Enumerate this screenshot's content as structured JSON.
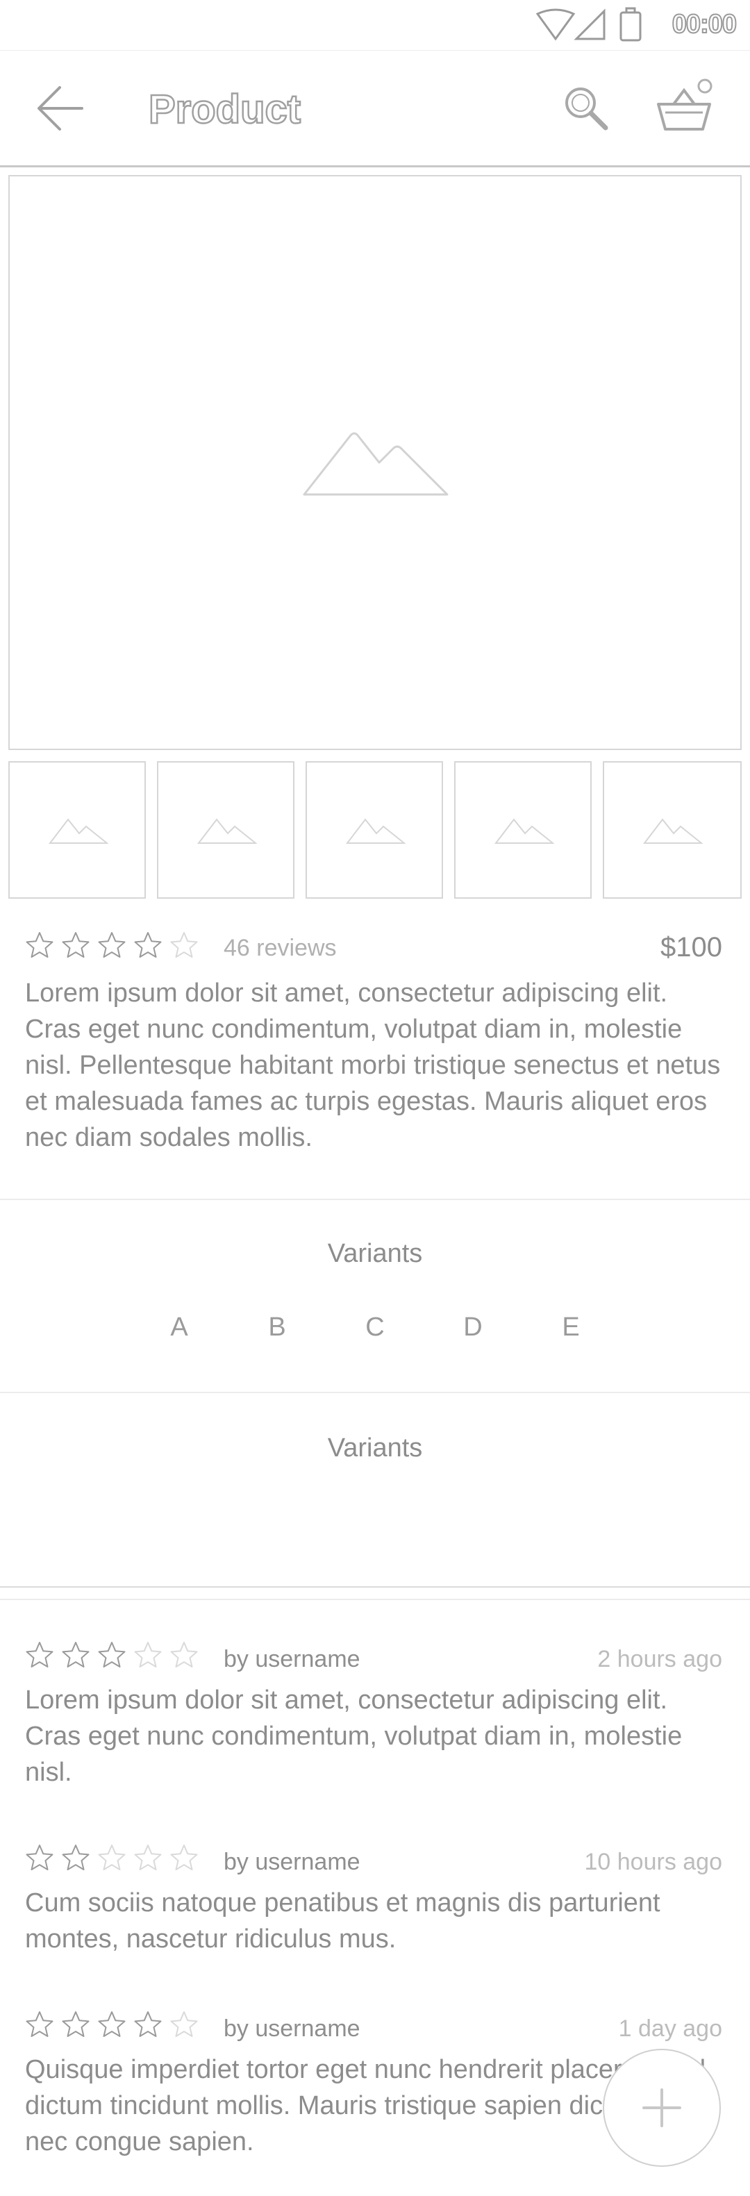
{
  "status_bar": {
    "time": "00:00"
  },
  "header": {
    "title": "Product"
  },
  "product": {
    "rating": 4,
    "reviews_label": "46 reviews",
    "price": "$100",
    "description": "Lorem ipsum dolor sit amet, consectetur adipiscing elit. Cras eget nunc condimentum, volutpat diam in, molestie nisl. Pellentesque habitant morbi tristique senectus et netus et malesuada fames ac turpis egestas. Mauris aliquet eros nec diam sodales mollis."
  },
  "variants_section_1": {
    "title": "Variants",
    "options": [
      "A",
      "B",
      "C",
      "D",
      "E"
    ]
  },
  "variants_section_2": {
    "title": "Variants"
  },
  "reviews": [
    {
      "rating": 3,
      "author": "by username",
      "time": "2 hours ago",
      "text": "Lorem ipsum dolor sit amet, consectetur adipiscing elit. Cras eget nunc condimentum, volutpat diam in, molestie nisl."
    },
    {
      "rating": 2,
      "author": "by username",
      "time": "10 hours ago",
      "text": "Cum sociis natoque penatibus et magnis dis parturient montes, nascetur ridiculus mus."
    },
    {
      "rating": 4,
      "author": "by username",
      "time": "1 day ago",
      "text": "Quisque imperdiet tortor eget nunc hendrerit placerat. Sed dictum tincidunt mollis. Mauris tristique sapien dictum. Duis nec congue sapien."
    }
  ],
  "colors": {
    "line": "#c8c8c8",
    "text": "#8c8c8c",
    "background": "#ffffff"
  }
}
